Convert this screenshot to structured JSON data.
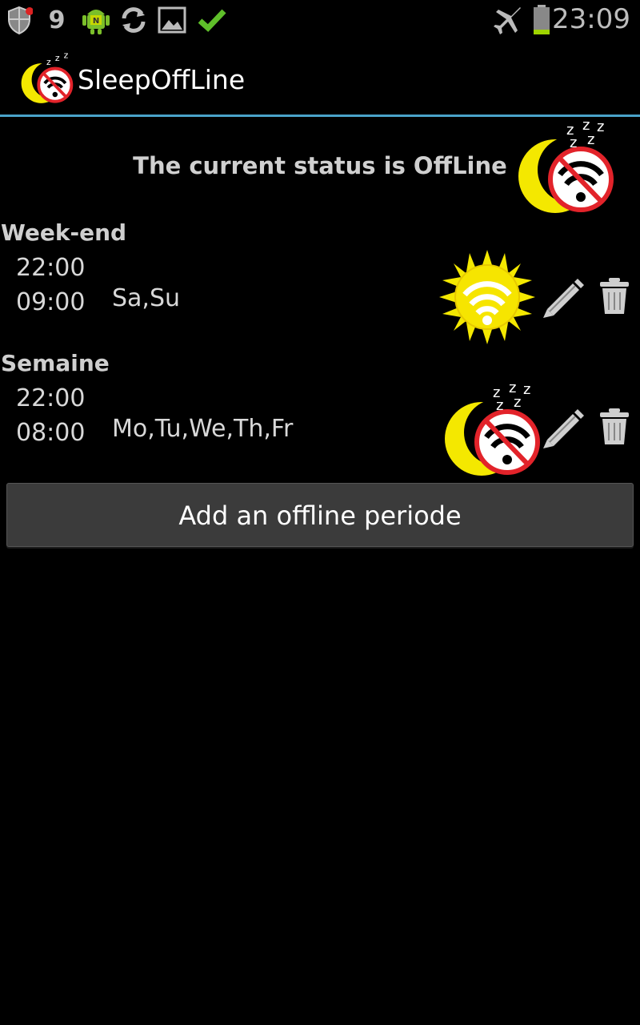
{
  "status_bar": {
    "notification_count": "9",
    "time": "23:09",
    "icons": [
      "shield-icon",
      "android-icon",
      "sync-icon",
      "image-icon",
      "check-icon",
      "airplane-icon",
      "battery-icon"
    ]
  },
  "app": {
    "title": "SleepOffLine",
    "accent_color": "#4aa3c9"
  },
  "status": {
    "text": "The current status is OffLine"
  },
  "periods": [
    {
      "name": "Week-end",
      "start": "22:00",
      "end": "09:00",
      "days": "Sa,Su",
      "icon": "sun-wifi-icon"
    },
    {
      "name": "Semaine",
      "start": "22:00",
      "end": "08:00",
      "days": "Mo,Tu,We,Th,Fr",
      "icon": "moon-no-wifi-icon"
    }
  ],
  "add_button": {
    "label": "Add an offline periode"
  }
}
